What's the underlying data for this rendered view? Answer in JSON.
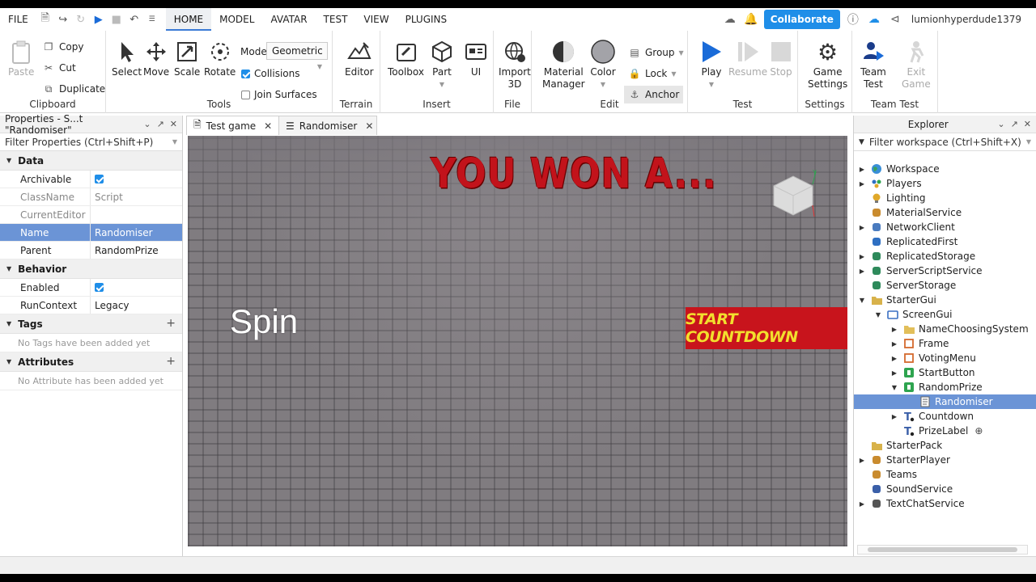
{
  "menubar": {
    "file": "FILE",
    "tabs": [
      "HOME",
      "MODEL",
      "AVATAR",
      "TEST",
      "VIEW",
      "PLUGINS"
    ],
    "collaborate": "Collaborate",
    "username": "lumionhyperdude1379"
  },
  "ribbon": {
    "clipboard": {
      "paste": "Paste",
      "copy": "Copy",
      "cut": "Cut",
      "duplicate": "Duplicate",
      "label": "Clipboard"
    },
    "tools": {
      "select": "Select",
      "move": "Move",
      "scale": "Scale",
      "rotate": "Rotate",
      "label": "Tools",
      "mode_label": "Mode:",
      "mode_value": "Geometric",
      "collisions": "Collisions",
      "join_surfaces": "Join Surfaces"
    },
    "terrain": {
      "editor": "Editor",
      "label": "Terrain"
    },
    "insert": {
      "toolbox": "Toolbox",
      "part": "Part",
      "ui": "UI",
      "label": "Insert"
    },
    "file": {
      "import_line1": "Import",
      "import_line2": "3D",
      "label": "File"
    },
    "edit": {
      "material_line1": "Material",
      "material_line2": "Manager",
      "color": "Color",
      "group": "Group",
      "lock": "Lock",
      "anchor": "Anchor",
      "label": "Edit"
    },
    "test": {
      "play": "Play",
      "resume": "Resume",
      "stop": "Stop",
      "label": "Test"
    },
    "settings": {
      "game_line1": "Game",
      "game_line2": "Settings",
      "label": "Settings"
    },
    "team_test": {
      "team_line1": "Team",
      "team_line2": "Test",
      "exit_line1": "Exit",
      "exit_line2": "Game",
      "label": "Team Test"
    }
  },
  "properties": {
    "title": "Properties - S...t \"Randomiser\"",
    "filter": "Filter Properties (Ctrl+Shift+P)",
    "sections": {
      "data": "Data",
      "behavior": "Behavior",
      "tags": "Tags",
      "attributes": "Attributes"
    },
    "rows": {
      "archivable": "Archivable",
      "classname": "ClassName",
      "classname_value": "Script",
      "currenteditor": "CurrentEditor",
      "name": "Name",
      "name_value": "Randomiser",
      "parent": "Parent",
      "parent_value": "RandomPrize",
      "enabled": "Enabled",
      "runcontext": "RunContext",
      "runcontext_value": "Legacy"
    },
    "no_tags": "No Tags have been added yet",
    "no_attributes": "No Attribute has been added yet"
  },
  "tabs": {
    "test_game": "Test game",
    "randomiser": "Randomiser"
  },
  "viewport": {
    "won_text": "YOU WON A...",
    "spin_text": "Spin",
    "countdown_text": "START COUNTDOWN",
    "axis_y": "Y"
  },
  "explorer": {
    "title": "Explorer",
    "filter": "Filter workspace (Ctrl+Shift+X)",
    "items": [
      {
        "label": "Workspace"
      },
      {
        "label": "Players"
      },
      {
        "label": "Lighting"
      },
      {
        "label": "MaterialService"
      },
      {
        "label": "NetworkClient"
      },
      {
        "label": "ReplicatedFirst"
      },
      {
        "label": "ReplicatedStorage"
      },
      {
        "label": "ServerScriptService"
      },
      {
        "label": "ServerStorage"
      },
      {
        "label": "StarterGui"
      },
      {
        "label": "ScreenGui"
      },
      {
        "label": "NameChoosingSystem"
      },
      {
        "label": "Frame"
      },
      {
        "label": "VotingMenu"
      },
      {
        "label": "StartButton"
      },
      {
        "label": "RandomPrize"
      },
      {
        "label": "Randomiser"
      },
      {
        "label": "Countdown"
      },
      {
        "label": "PrizeLabel"
      },
      {
        "label": "StarterPack"
      },
      {
        "label": "StarterPlayer"
      },
      {
        "label": "Teams"
      },
      {
        "label": "SoundService"
      },
      {
        "label": "TextChatService"
      }
    ]
  },
  "colors": {
    "accent": "#1f8ee8",
    "selection": "#6b94d6",
    "won_red": "#c2131b",
    "button_red": "#c8141c",
    "button_text": "#f2df2e"
  }
}
